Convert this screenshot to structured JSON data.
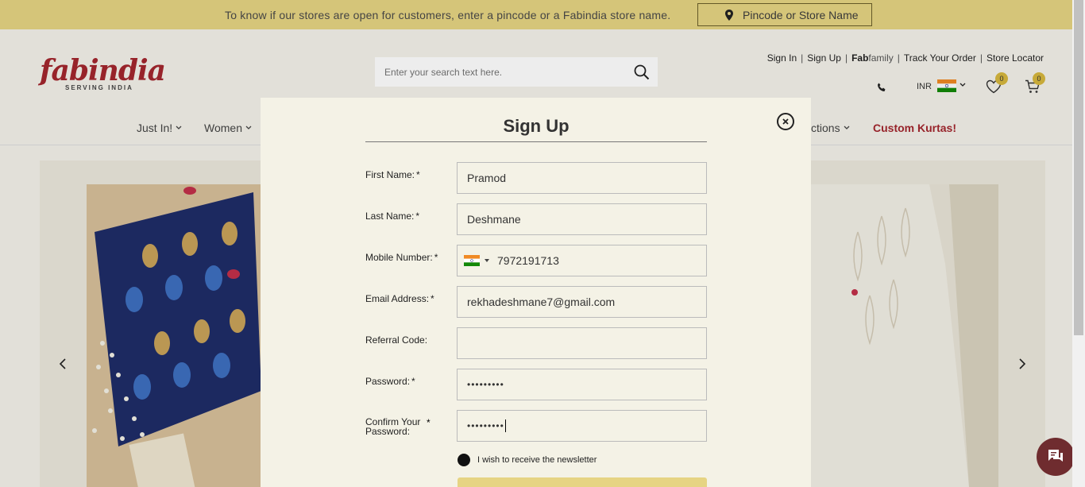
{
  "topbar": {
    "message": "To know if our stores are open for customers, enter a pincode or a Fabindia store name.",
    "store_button": "Pincode or Store Name"
  },
  "logo": {
    "word": "fabindia",
    "tagline": "SERVING INDIA"
  },
  "search": {
    "placeholder": "Enter your search text here."
  },
  "toplinks": {
    "sign_in": "Sign In",
    "sign_up": "Sign Up",
    "fabfamily_bold": "Fab",
    "fabfamily_light": "family",
    "track_order": "Track Your Order",
    "store_locator": "Store Locator"
  },
  "utility": {
    "currency": "INR",
    "wishlist_count": "0",
    "cart_count": "0"
  },
  "nav": {
    "just_in": "Just In!",
    "women": "Women",
    "collections": "ctions",
    "custom_kurtas": "Custom Kurtas!"
  },
  "modal": {
    "title": "Sign Up",
    "first_name_label": "First Name:",
    "first_name_value": "Pramod",
    "last_name_label": "Last Name:",
    "last_name_value": "Deshmane",
    "mobile_label": "Mobile Number:",
    "mobile_value": "7972191713",
    "email_label": "Email Address:",
    "email_value": "rekhadeshmane7@gmail.com",
    "referral_label": "Referral Code:",
    "referral_value": "",
    "password_label": "Password:",
    "password_value": "•••••••••",
    "confirm_label_line1": "Confirm Your",
    "confirm_label_line2": "Password:",
    "confirm_value": "•••••••••",
    "required_mark": "*",
    "newsletter_label": "I wish to receive the newsletter"
  },
  "colors": {
    "topbar": "#e6d483",
    "brand": "#a3262e",
    "modal_bg": "#f4f2e6",
    "chat": "#6f2c2f"
  }
}
